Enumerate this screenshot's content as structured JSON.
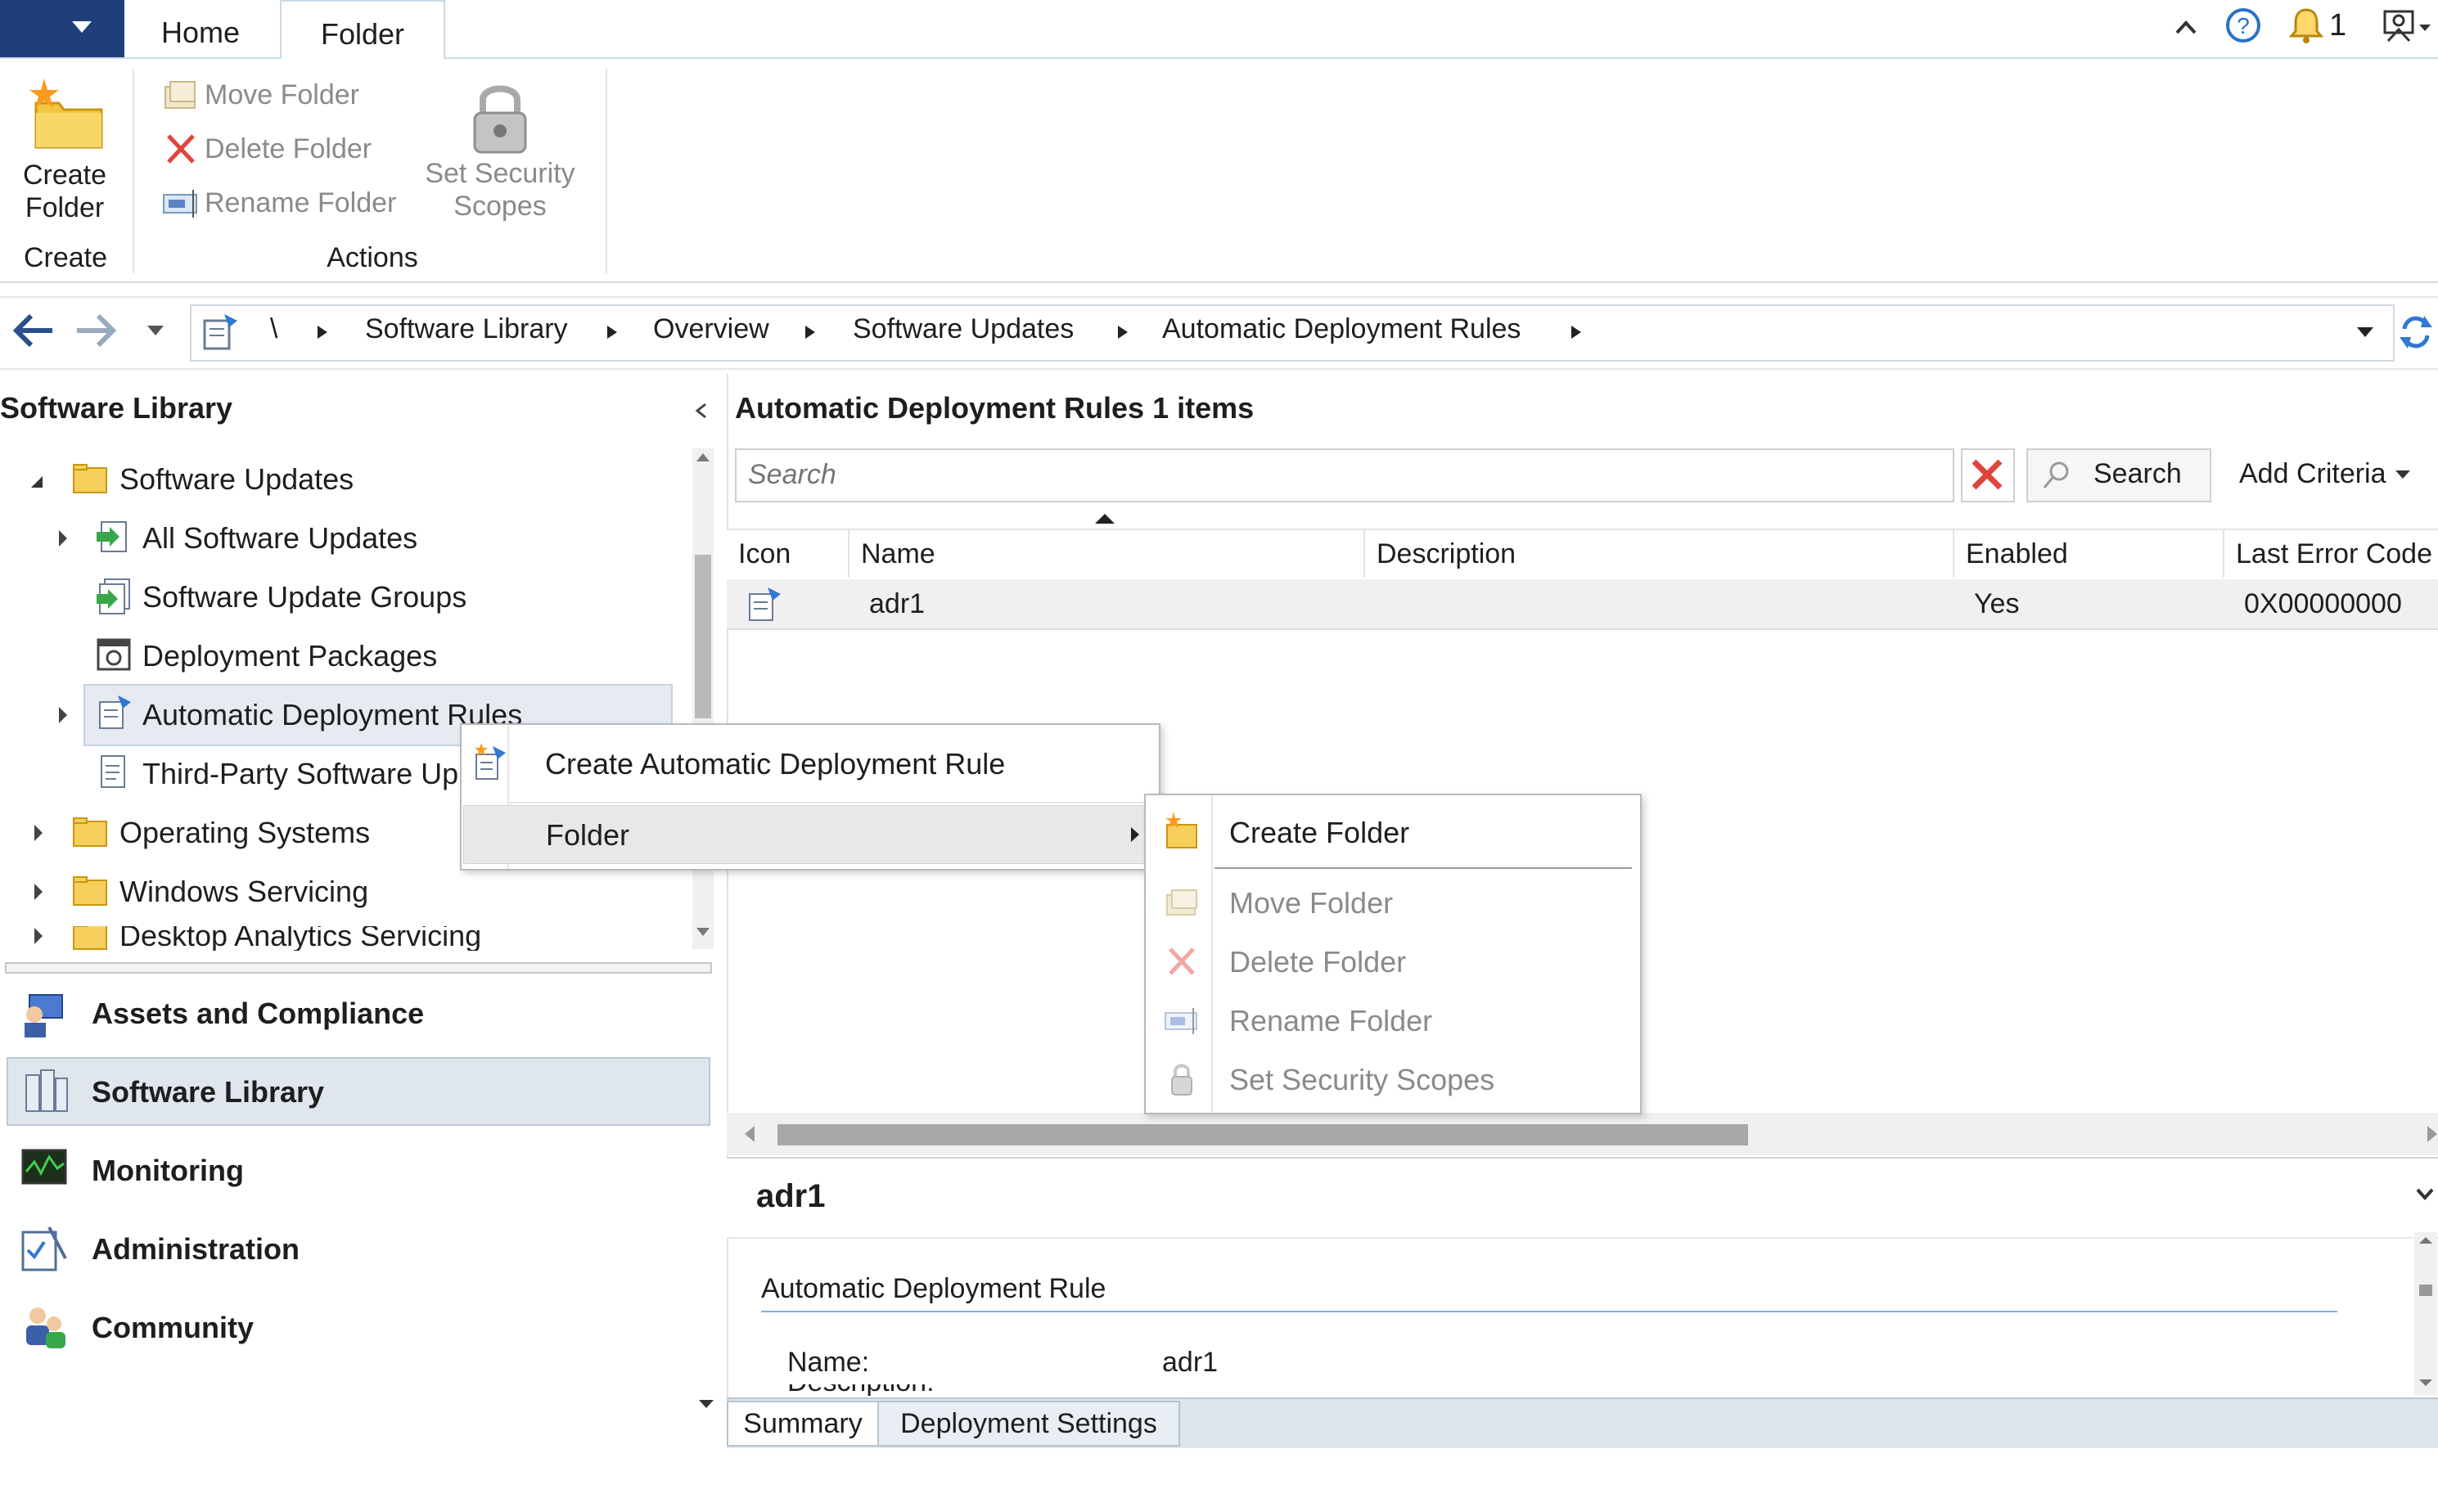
{
  "ribbon": {
    "tabs": [
      "Home",
      "Folder"
    ],
    "notification_count": "1",
    "buttons": {
      "create_folder": [
        "Create",
        "Folder"
      ],
      "move_folder": "Move Folder",
      "delete_folder": "Delete Folder",
      "rename_folder": "Rename Folder",
      "set_security_scopes": [
        "Set Security",
        "Scopes"
      ]
    },
    "groups": [
      "Create",
      "Actions"
    ]
  },
  "breadcrumb": {
    "root": "\\",
    "items": [
      "Software Library",
      "Overview",
      "Software Updates",
      "Automatic Deployment Rules"
    ]
  },
  "nav": {
    "title": "Software Library",
    "tree": [
      "Software Updates",
      "All Software Updates",
      "Software Update Groups",
      "Deployment Packages",
      "Automatic Deployment Rules",
      "Third-Party Software Up",
      "Operating Systems",
      "Windows Servicing",
      "Desktop Analytics Servicing"
    ],
    "workspaces": [
      "Assets and Compliance",
      "Software Library",
      "Monitoring",
      "Administration",
      "Community"
    ]
  },
  "content": {
    "title": "Automatic Deployment Rules 1 items",
    "search_placeholder": "Search",
    "search_button": "Search",
    "add_criteria": "Add Criteria",
    "columns": [
      "Icon",
      "Name",
      "Description",
      "Enabled",
      "Last Error Code"
    ],
    "rows": [
      {
        "name": "adr1",
        "description": "",
        "enabled": "Yes",
        "last_error_code": "0X00000000"
      }
    ]
  },
  "context_menu": {
    "items": [
      "Create Automatic Deployment Rule",
      "Folder"
    ],
    "submenu": [
      "Create Folder",
      "Move Folder",
      "Delete Folder",
      "Rename Folder",
      "Set Security Scopes"
    ]
  },
  "details": {
    "title": "adr1",
    "section": "Automatic Deployment Rule",
    "name_label": "Name:",
    "name_value": "adr1",
    "description_label": "Description:",
    "tabs": [
      "Summary",
      "Deployment Settings"
    ]
  },
  "colors": {
    "app_menu": "#1f3f7a",
    "selection": "#dfe6ee",
    "ribbon_border": "#c9dbe9"
  }
}
